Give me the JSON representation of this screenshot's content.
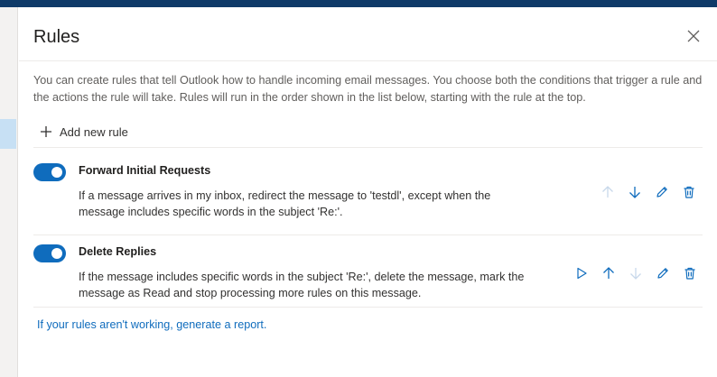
{
  "dialog": {
    "title": "Rules",
    "description": "You can create rules that tell Outlook how to handle incoming email messages. You choose both the conditions that trigger a rule and the actions the rule will take. Rules will run in the order shown in the list below, starting with the rule at the top.",
    "add_rule_label": "Add new rule",
    "report_link": "If your rules aren't working, generate a report."
  },
  "rules": [
    {
      "name": "Forward Initial Requests",
      "description": "If a message arrives in my inbox, redirect the message to 'testdl', except when the message includes specific words in the subject 'Re:'.",
      "enabled": true
    },
    {
      "name": "Delete Replies",
      "description": "If the message includes specific words in the subject 'Re:', delete the message, mark the message as Read and stop processing more rules on this message.",
      "enabled": true
    }
  ],
  "icons": {
    "close": "close-icon",
    "add": "plus-icon",
    "run": "play-icon",
    "move_up": "arrow-up-icon",
    "move_down": "arrow-down-icon",
    "edit": "pencil-icon",
    "delete": "trash-icon"
  },
  "colors": {
    "accent": "#0f6cbd",
    "header_bar": "#0f3a68",
    "icon_active": "#0f6cbd",
    "icon_disabled": "#c8d8ea"
  }
}
